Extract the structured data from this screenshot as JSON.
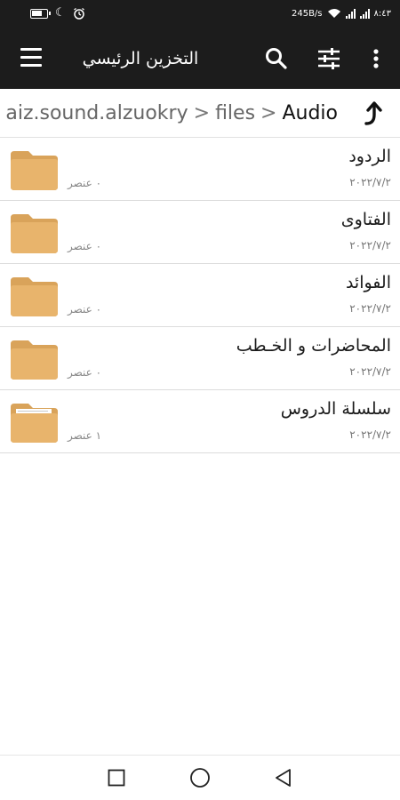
{
  "status_bar": {
    "network_speed": "245B/s",
    "time": "٨:٤٣"
  },
  "app_bar": {
    "title": "التخزين الرئيسي",
    "icons": [
      "menu-icon",
      "search-icon",
      "sliders-icon",
      "more-vert-icon"
    ]
  },
  "breadcrumb": {
    "segments": [
      "aiz.sound.alzuokry",
      "files",
      "Audio"
    ],
    "separator": ">",
    "up_icon": "arrow-up-icon"
  },
  "files": [
    {
      "name": "الردود",
      "date": "٢٠٢٢/٧/٢",
      "count": "٠ عنصر",
      "icon": "folder-icon"
    },
    {
      "name": "الفتاوى",
      "date": "٢٠٢٢/٧/٢",
      "count": "٠ عنصر",
      "icon": "folder-icon"
    },
    {
      "name": "الفوائد",
      "date": "٢٠٢٢/٧/٢",
      "count": "٠ عنصر",
      "icon": "folder-icon"
    },
    {
      "name": "المحاضرات و الخـطب",
      "date": "٢٠٢٢/٧/٢",
      "count": "٠ عنصر",
      "icon": "folder-icon"
    },
    {
      "name": "سلسلة الدروس",
      "date": "٢٠٢٢/٧/٢",
      "count": "١ عنصر",
      "icon": "folder-with-files-icon"
    }
  ],
  "nav_bar": {
    "icons": [
      "recents-square-icon",
      "home-circle-icon",
      "back-triangle-icon"
    ]
  },
  "colors": {
    "app_bar": "#1c1c1c",
    "folder": "#e8b46c",
    "folder_back": "#d9a35a"
  }
}
